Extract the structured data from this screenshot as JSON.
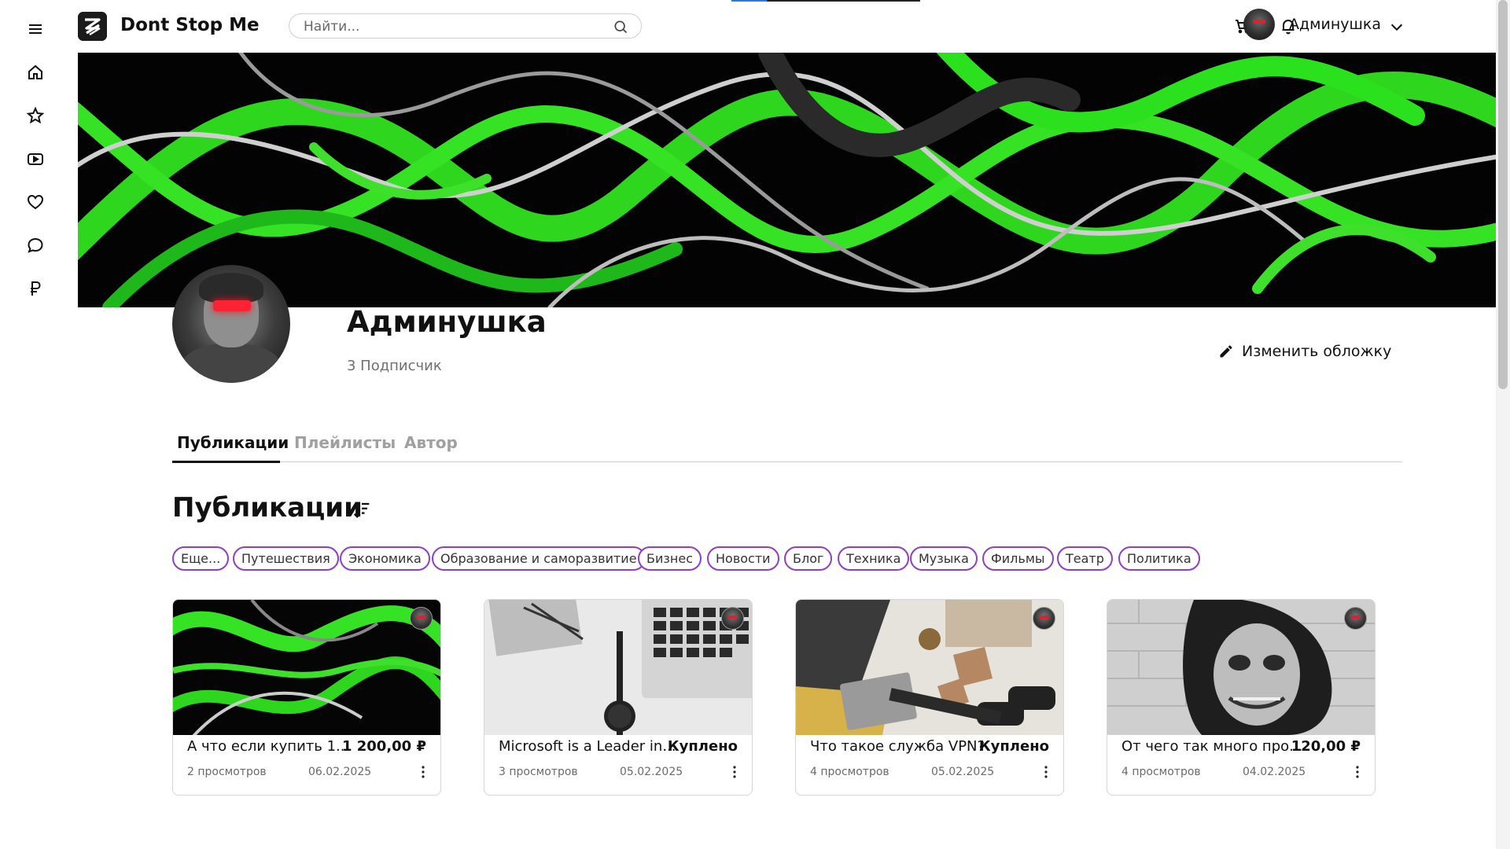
{
  "header": {
    "brand": "Dont Stop Me",
    "search_placeholder": "Найти...",
    "username": "Админушка",
    "icons": [
      "menu-icon",
      "cart-icon",
      "bell-icon",
      "chevron-down-icon"
    ]
  },
  "sidebar": {
    "items": [
      {
        "name": "menu",
        "icon": "menu-icon"
      },
      {
        "name": "home",
        "icon": "home-icon"
      },
      {
        "name": "favorites",
        "icon": "star-icon"
      },
      {
        "name": "video",
        "icon": "play-icon"
      },
      {
        "name": "likes",
        "icon": "heart-icon"
      },
      {
        "name": "messages",
        "icon": "chat-icon"
      },
      {
        "name": "payments",
        "icon": "ruble-icon"
      }
    ]
  },
  "profile": {
    "name": "Админушка",
    "subscribers": "3 Подписчик",
    "edit_cover_label": "Изменить обложку"
  },
  "tabs": [
    {
      "label": "Публикации",
      "active": true
    },
    {
      "label": "Плейлисты",
      "active": false
    },
    {
      "label": "Автор",
      "active": false
    }
  ],
  "section": {
    "title": "Публикации"
  },
  "chips": [
    "Еще...",
    "Путешествия",
    "Экономика",
    "Образование и саморазвитие",
    "Бизнес",
    "Новости",
    "Блог",
    "Техника",
    "Музыка",
    "Фильмы",
    "Театр",
    "Политика"
  ],
  "cards": [
    {
      "title": "А что если купить 1...",
      "price": "1 200,00 ₽",
      "views": "2 просмотров",
      "date": "06.02.2025",
      "thumb": "green-abstract"
    },
    {
      "title": "Microsoft is a Leader in...",
      "price": "Куплено",
      "views": "3 просмотров",
      "date": "05.02.2025",
      "thumb": "desk-laptop-watch"
    },
    {
      "title": "Что такое служба VPN?",
      "price": "Куплено",
      "views": "4 просмотров",
      "date": "05.02.2025",
      "thumb": "person-laptop-floor"
    },
    {
      "title": "От чего так много про...",
      "price": "120,00 ₽",
      "views": "4 просмотров",
      "date": "04.02.2025",
      "thumb": "joker-portrait"
    }
  ],
  "colors": {
    "chip_border": "#8e3fc4",
    "accent_green": "#3ee02b",
    "active_tab": "#111111",
    "inactive_tab": "#a0a0a0"
  }
}
